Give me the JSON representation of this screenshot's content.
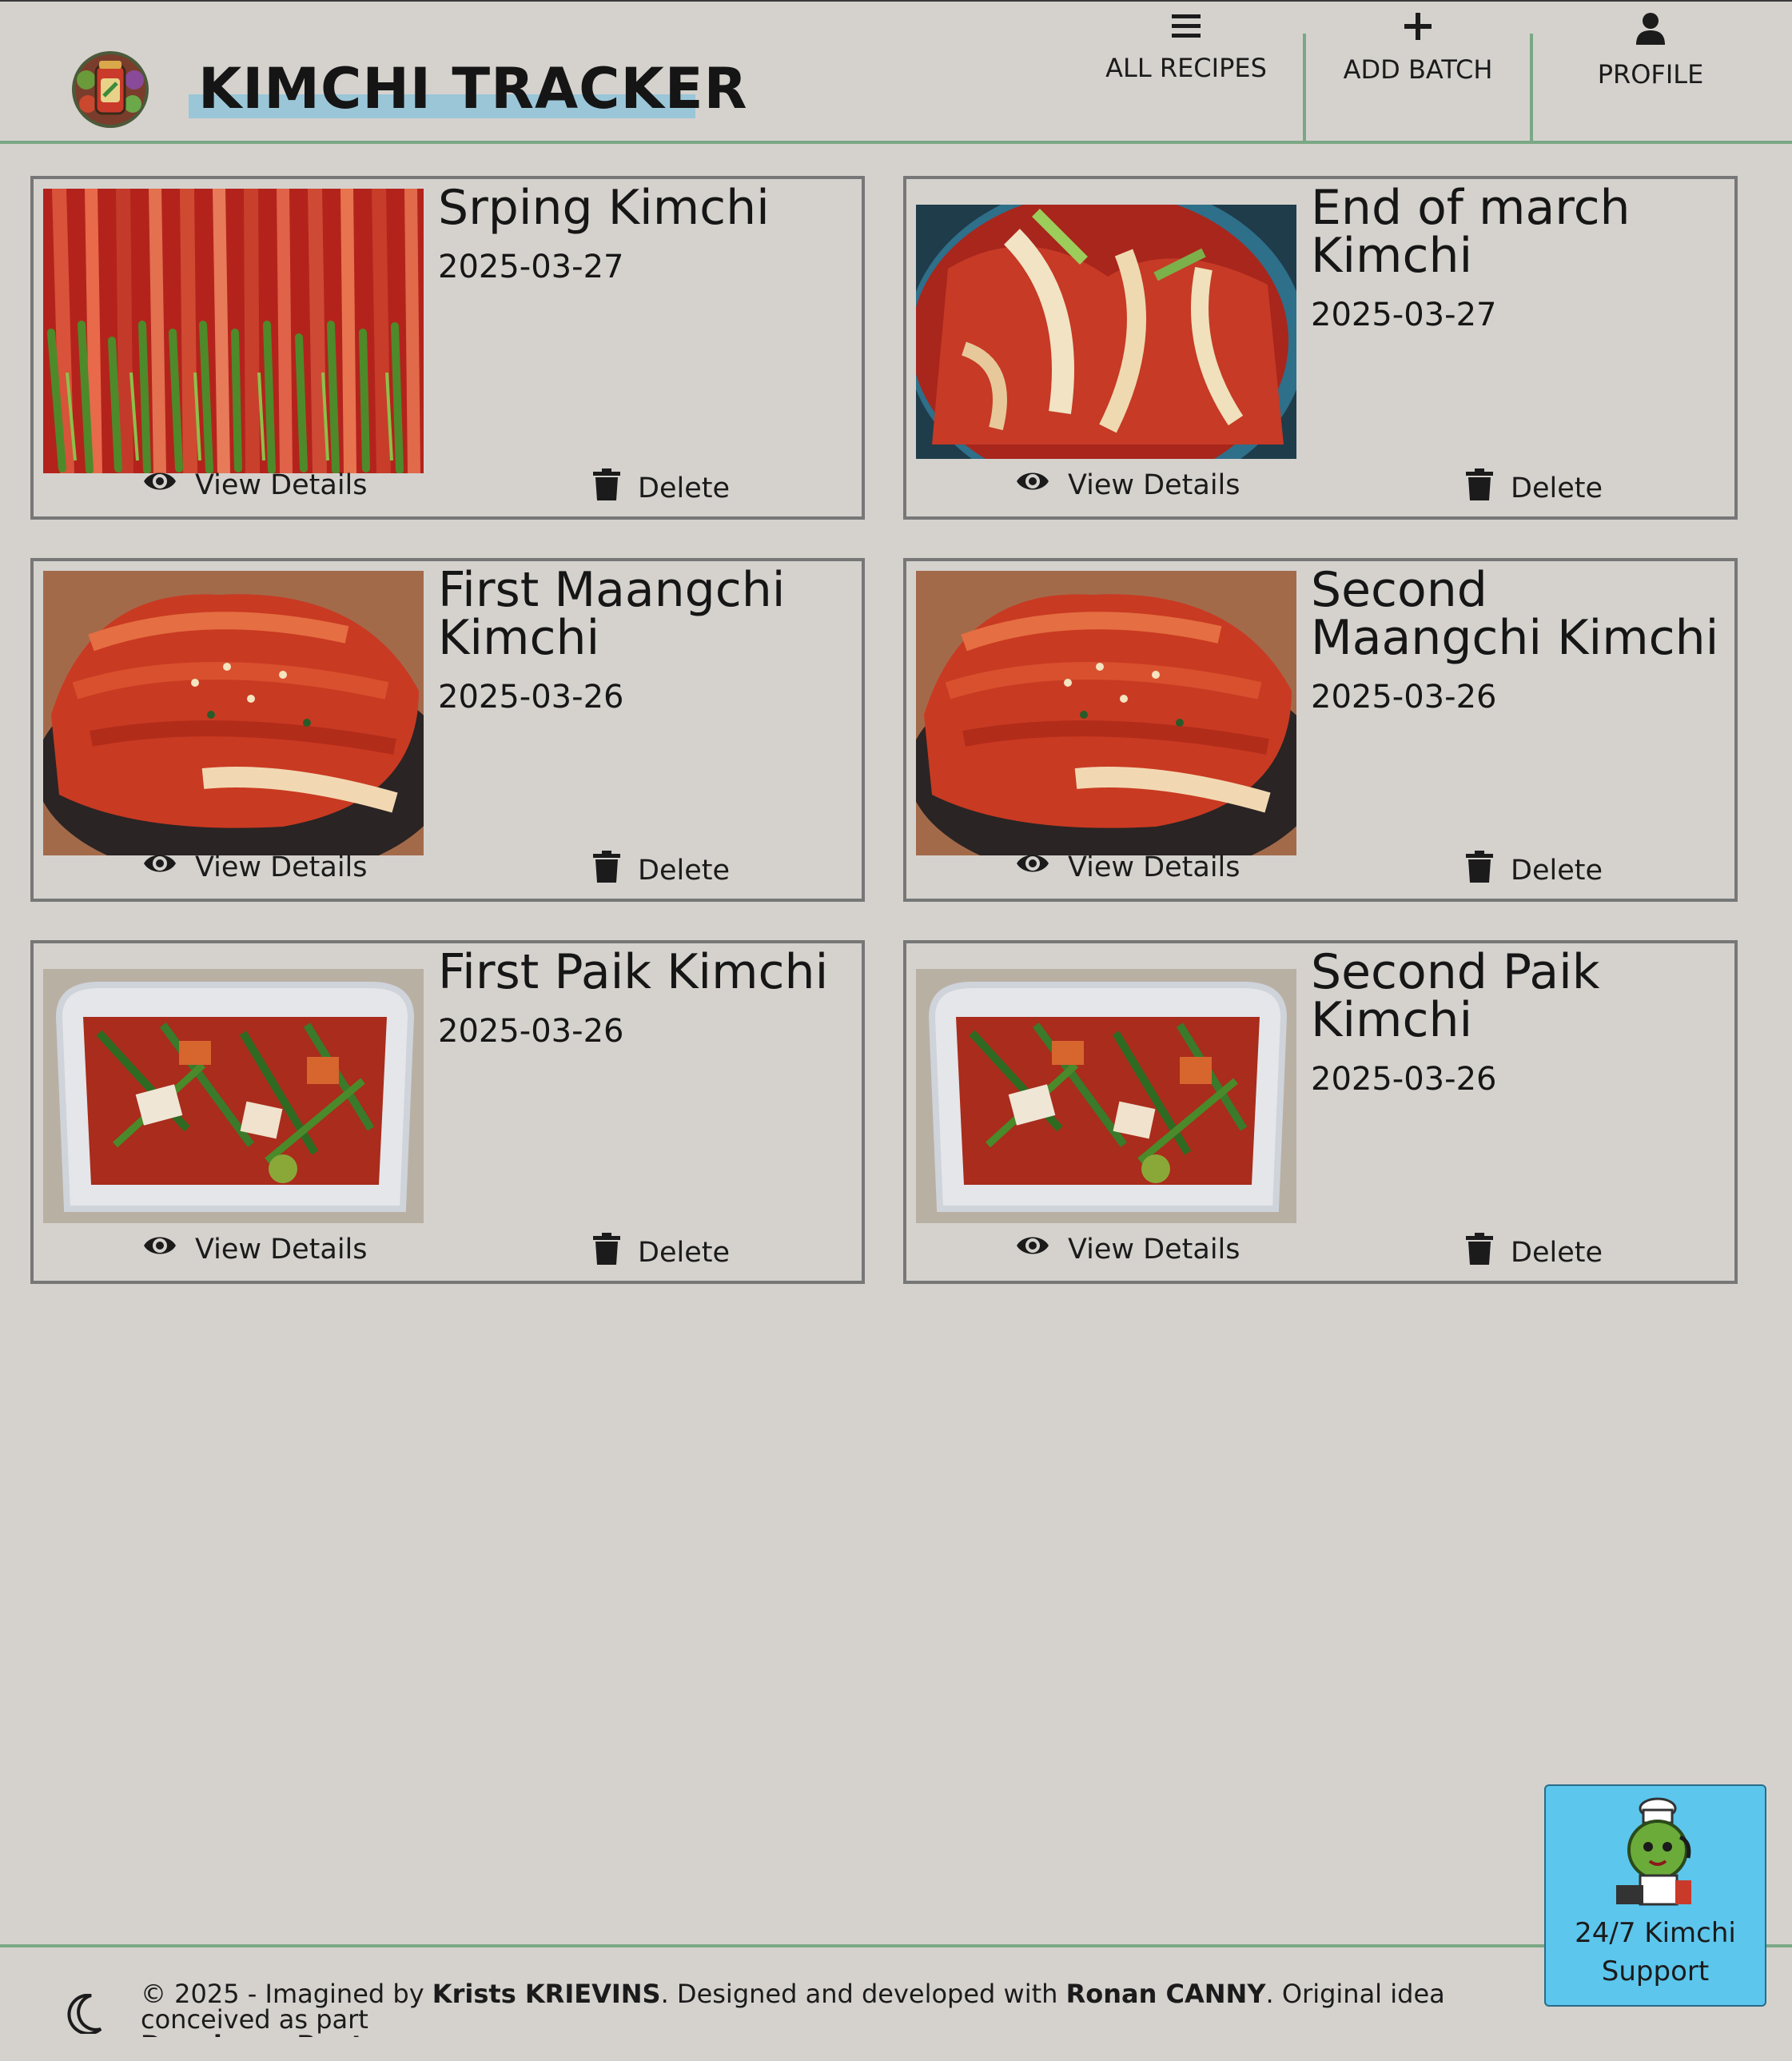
{
  "app": {
    "title": "KIMCHI TRACKER",
    "accent_color": "#7aa884",
    "highlight_color": "#9ac6d8",
    "logo_icon": "kimchi-jar-logo"
  },
  "nav": {
    "all_recipes": {
      "label": "ALL RECIPES",
      "icon": "menu-icon"
    },
    "add_batch": {
      "label": "ADD BATCH",
      "icon": "plus-icon"
    },
    "profile": {
      "label": "PROFILE",
      "icon": "user-icon"
    }
  },
  "cards": [
    {
      "title": "Srping Kimchi",
      "date": "2025-03-27",
      "image": "green-onion-kimchi-photo"
    },
    {
      "title": "End of march Kimchi",
      "date": "2025-03-27",
      "image": "cabbage-kimchi-bowl-photo"
    },
    {
      "title": "First Maangchi Kimchi",
      "date": "2025-03-26",
      "image": "napa-cabbage-kimchi-photo"
    },
    {
      "title": "Second Maangchi Kimchi",
      "date": "2025-03-26",
      "image": "napa-cabbage-kimchi-photo"
    },
    {
      "title": "First Paik Kimchi",
      "date": "2025-03-26",
      "image": "container-kimchi-photo"
    },
    {
      "title": "Second Paik Kimchi",
      "date": "2025-03-26",
      "image": "container-kimchi-photo"
    }
  ],
  "card_actions": {
    "view_label": "View Details",
    "delete_label": "Delete"
  },
  "support": {
    "label_line1": "24/7 Kimchi",
    "label_line2": "Support",
    "color": "#5cc6ed",
    "icon": "cabbage-chef-mascot"
  },
  "footer": {
    "prefix": "© 2025 - Imagined by ",
    "author": "Krists KRIEVINS",
    "middle": ". Designed and developed with ",
    "collaborator": "Ronan CANNY",
    "suffix": ". Original idea conceived as part",
    "program": "Developer Bootcamp",
    "end": ".",
    "theme_toggle_icon": "moon-icon"
  }
}
